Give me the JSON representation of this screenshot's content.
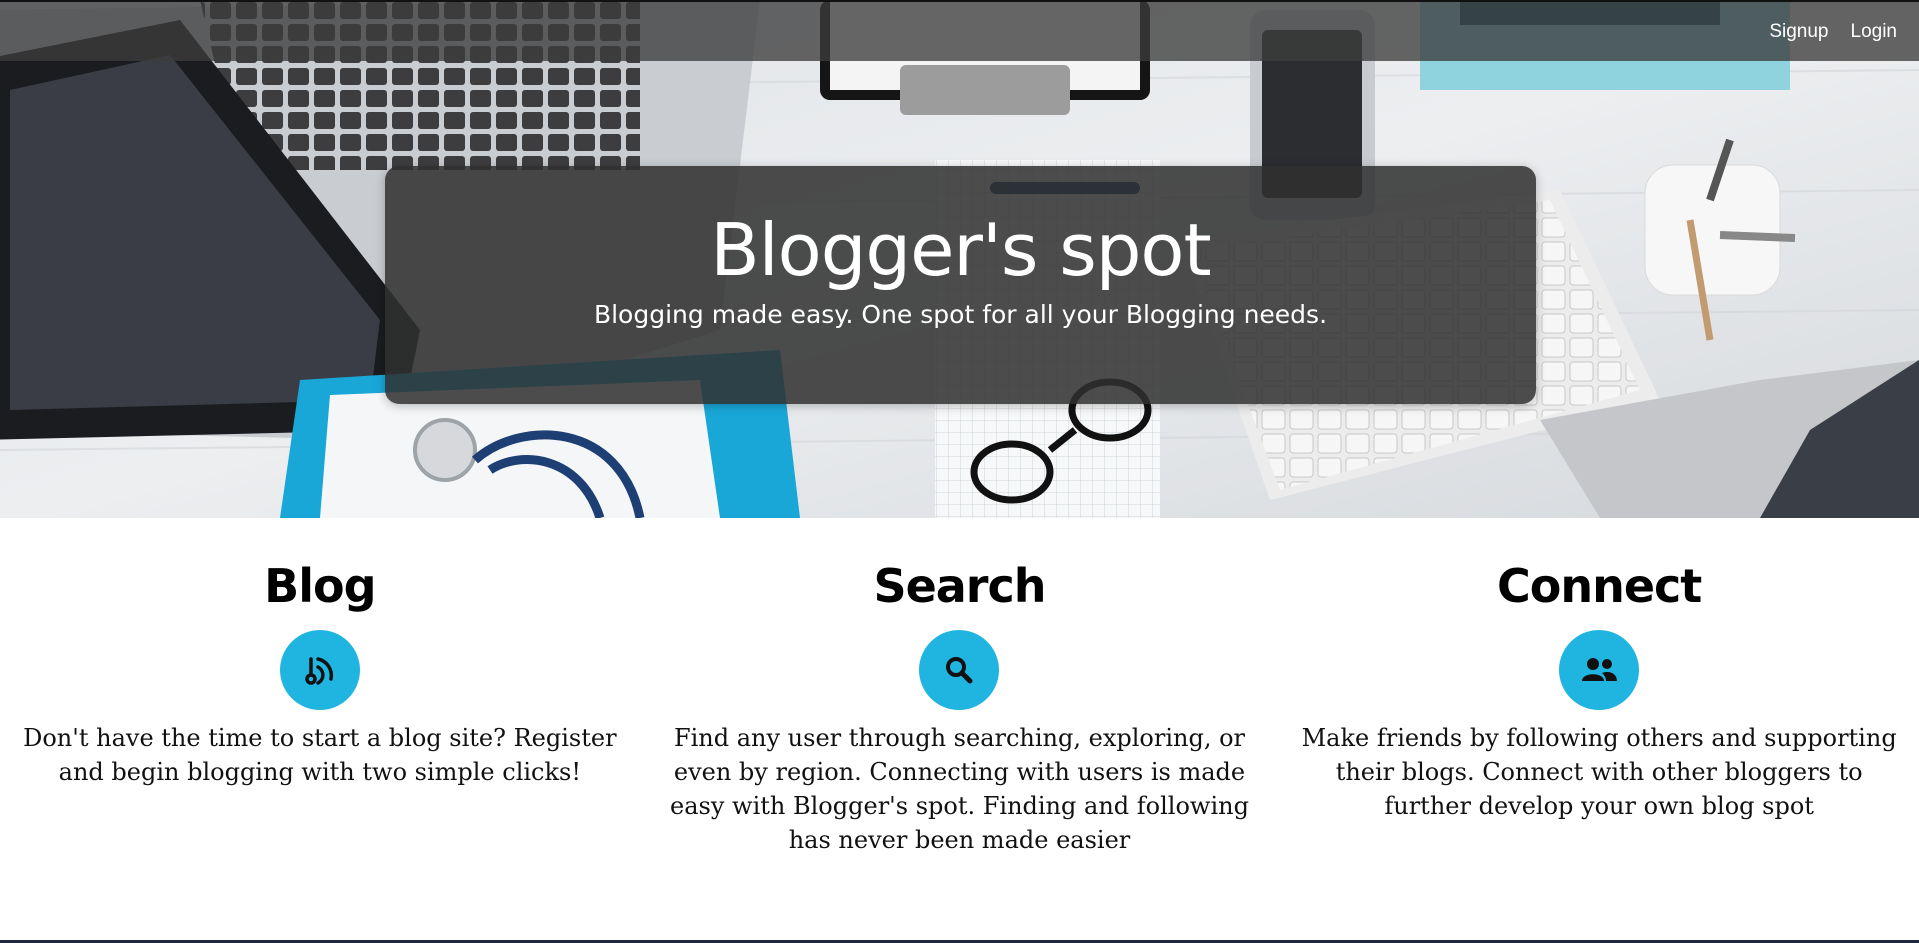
{
  "nav": {
    "signup_label": "Signup",
    "login_label": "Login"
  },
  "hero": {
    "title": "Blogger's spot",
    "subtitle": "Blogging made easy. One spot for all your Blogging needs."
  },
  "features": [
    {
      "title": "Blog",
      "icon": "blog-icon",
      "description": "Don't have the time to start a blog site? Register and begin blogging with two simple clicks!"
    },
    {
      "title": "Search",
      "icon": "search-icon",
      "description": "Find any user through searching, exploring, or even by region. Connecting with users is made easy with Blogger's spot. Finding and following has never been made easier"
    },
    {
      "title": "Connect",
      "icon": "users-icon",
      "description": "Make friends by following others and supporting their blogs. Connect with other bloggers to further develop your own blog spot"
    }
  ],
  "colors": {
    "accent": "#1fb5e0",
    "navbar": "#3c3c3c",
    "jumbotron": "#303030"
  }
}
